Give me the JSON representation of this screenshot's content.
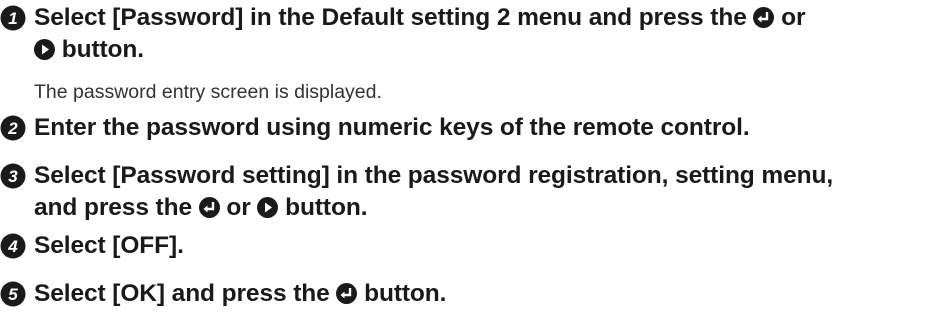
{
  "steps": [
    {
      "number": "1",
      "line1_a": "Select [Password] in the Default setting 2 menu and press the ",
      "line1_or": " or",
      "line2_b": " button."
    },
    {
      "number": "2",
      "text": "Enter the password using numeric keys of the remote control."
    },
    {
      "number": "3",
      "line1": "Select [Password setting] in the password registration, setting menu,",
      "line2_a": "and press the ",
      "line2_or": " or ",
      "line2_b": " button."
    },
    {
      "number": "4",
      "text": "Select [OFF]."
    },
    {
      "number": "5",
      "text_a": "Select [OK] and press the ",
      "text_b": " button."
    }
  ],
  "note": "The password entry screen is displayed.",
  "icons": {
    "enter": "enter-icon",
    "right": "right-arrow-icon"
  },
  "colors": {
    "text": "#1a1a1a",
    "icon": "#1a1a1a"
  }
}
